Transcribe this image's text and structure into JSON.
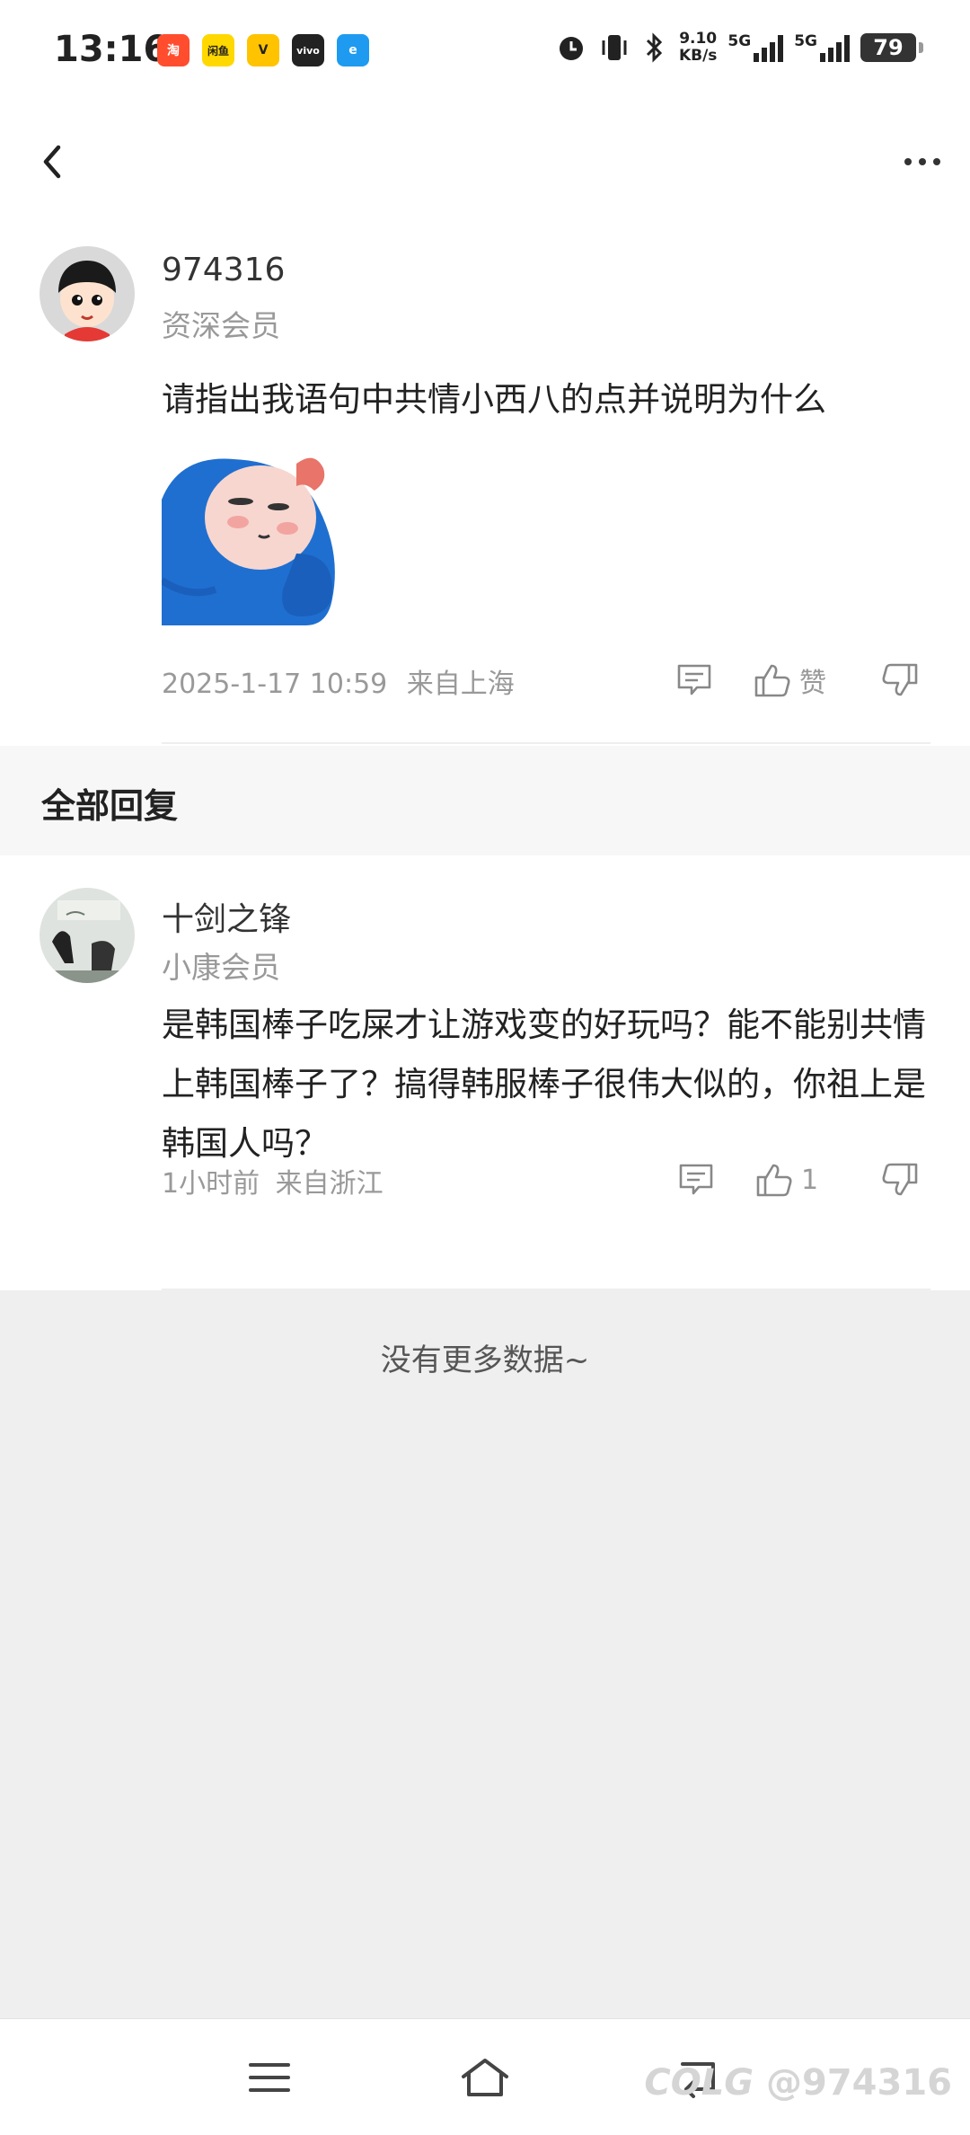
{
  "status_bar": {
    "time": "13:16",
    "apps": [
      {
        "icon": "taobao-icon",
        "label": "淘",
        "color": "#ff4d2e"
      },
      {
        "icon": "xianyu-icon",
        "label": "闲鱼",
        "color": "#ffd800"
      },
      {
        "icon": "meituan-icon",
        "label": "V",
        "color": "#ffc300"
      },
      {
        "icon": "vivo-icon",
        "label": "vivo",
        "color": "#222222"
      },
      {
        "icon": "eleme-icon",
        "label": "e",
        "color": "#1e9bf0"
      }
    ],
    "speed_value": "9.10",
    "speed_unit": "KB/s",
    "network1": "5G",
    "network2": "5G",
    "battery": "79"
  },
  "post": {
    "username": "974316",
    "level": "资深会员",
    "content": "请指出我语句中共情小西八的点并说明为什么",
    "timestamp": "2025-1-17 10:59",
    "location": "来自上海",
    "like_label": "赞"
  },
  "section_title": "全部回复",
  "reply": {
    "username": "十剑之锋",
    "level": "小康会员",
    "content": "是韩国棒子吃屎才让游戏变的好玩吗？能不能别共情上韩国棒子了？搞得韩服棒子很伟大似的，你祖上是韩国人吗？",
    "timestamp": "1小时前",
    "location": "来自浙江",
    "like_count": "1"
  },
  "no_more_text": "没有更多数据~",
  "watermark": "@974316",
  "watermark_logo": "COLG"
}
